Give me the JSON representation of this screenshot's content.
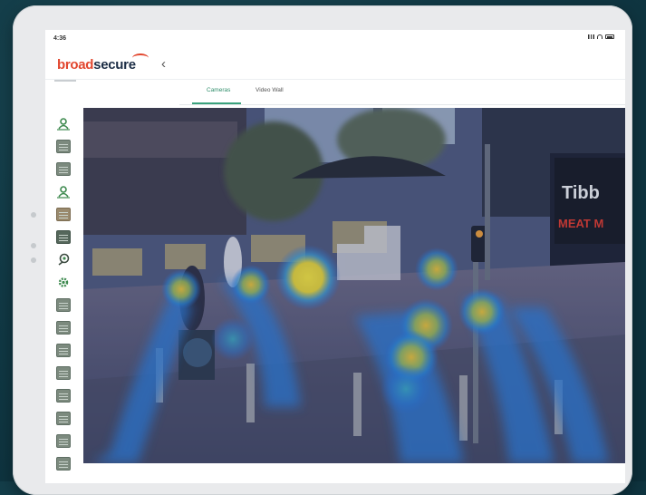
{
  "status_bar": {
    "time": "4:36"
  },
  "app": {
    "brand_part1": "broad",
    "brand_part2": "secure",
    "back_glyph": "‹"
  },
  "tabs": [
    {
      "label": "Cameras",
      "active": true
    },
    {
      "label": "Video Wall",
      "active": false
    }
  ],
  "sidebar_icons": [
    "person-location-icon",
    "camera-tile-icon",
    "camera-tile-icon",
    "person-location-icon",
    "camera-tile-icon",
    "camera-tile-icon",
    "dome-camera-icon",
    "settings-gear-icon",
    "camera-tile-icon",
    "camera-tile-icon",
    "camera-tile-icon",
    "camera-tile-icon",
    "camera-tile-icon",
    "camera-tile-icon",
    "camera-tile-icon",
    "camera-tile-icon"
  ],
  "video_feed": {
    "overlay": "heatmap",
    "storefront_sign_line1": "Tibb",
    "storefront_sign_line2": "MEAT M"
  },
  "colors": {
    "brand_red": "#e2472f",
    "brand_navy": "#1c2d45",
    "tab_active": "#2f8d6a",
    "heat_hot": "#f2e23a",
    "heat_cool": "#2a8fe0"
  }
}
